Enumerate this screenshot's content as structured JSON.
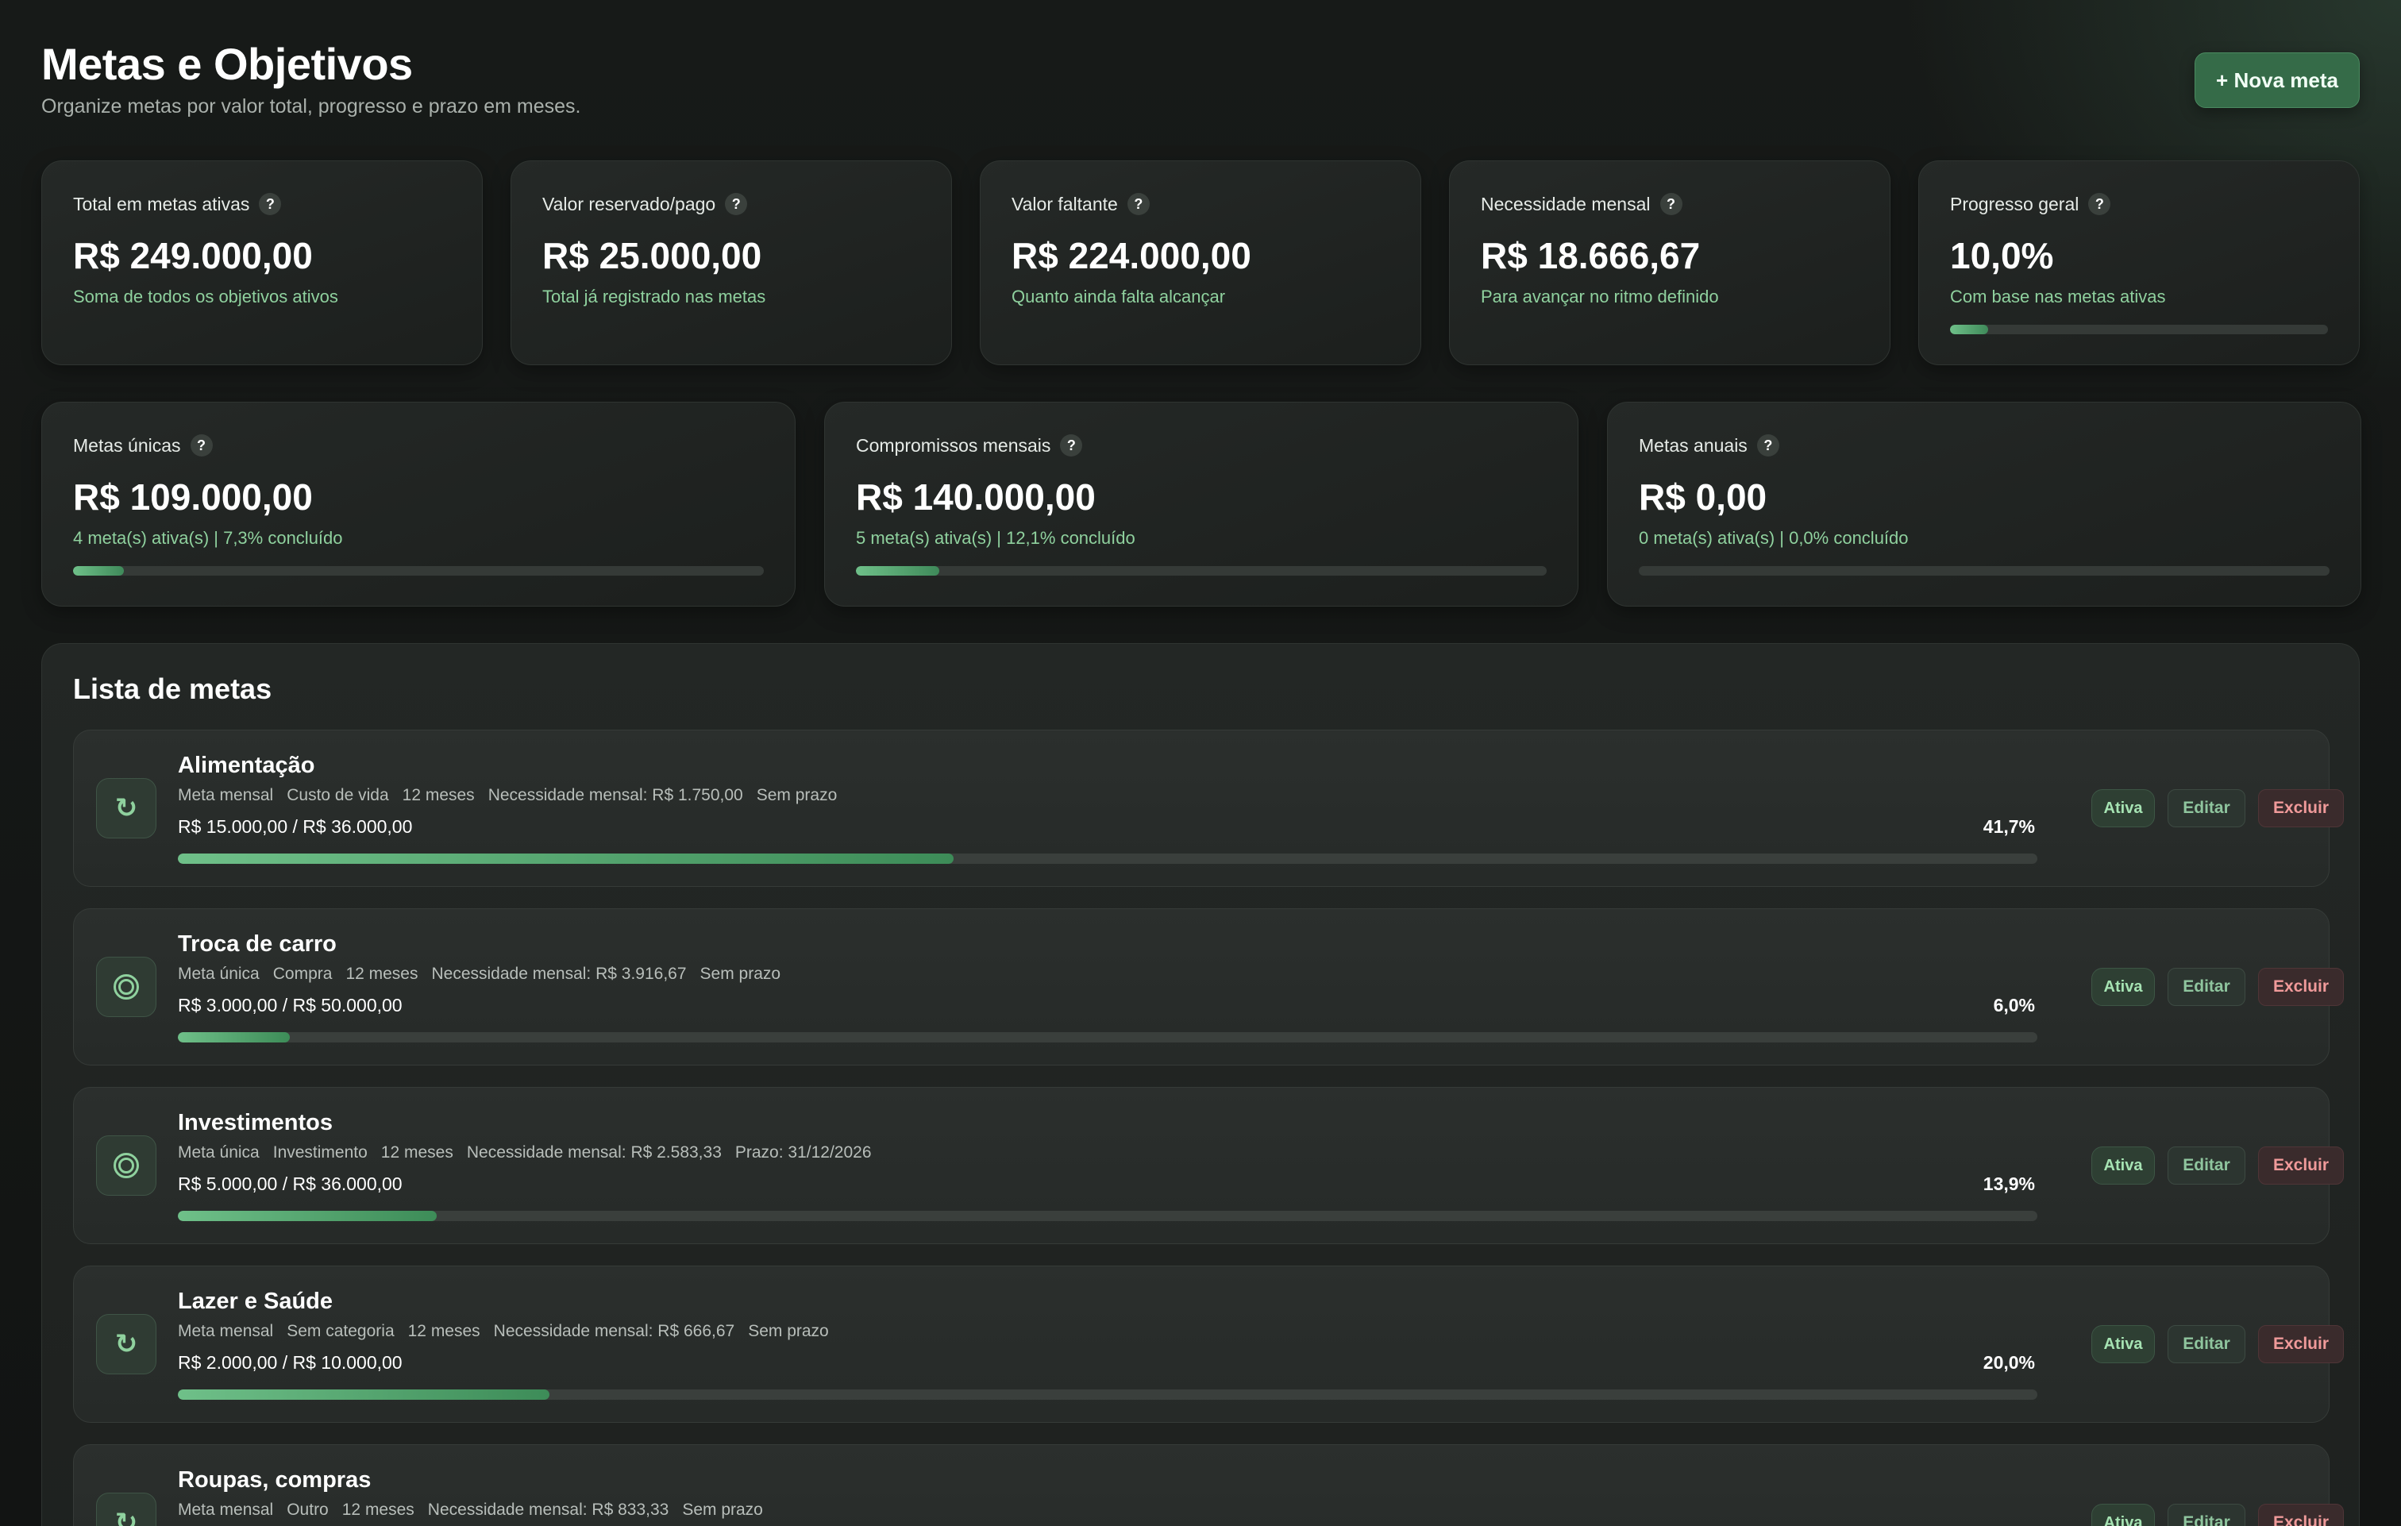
{
  "header": {
    "title": "Metas e Objetivos",
    "subtitle": "Organize metas por valor total, progresso e prazo em meses.",
    "new_goal_label": "+ Nova meta"
  },
  "summary_cards": [
    {
      "label": "Total em metas ativas",
      "value": "R$ 249.000,00",
      "caption": "Soma de todos os objetivos ativos"
    },
    {
      "label": "Valor reservado/pago",
      "value": "R$ 25.000,00",
      "caption": "Total já registrado nas metas"
    },
    {
      "label": "Valor faltante",
      "value": "R$ 224.000,00",
      "caption": "Quanto ainda falta alcançar"
    },
    {
      "label": "Necessidade mensal",
      "value": "R$ 18.666,67",
      "caption": "Para avançar no ritmo definido"
    },
    {
      "label": "Progresso geral",
      "value": "10,0%",
      "caption": "Com base nas metas ativas",
      "progress": 0.1
    }
  ],
  "type_cards": [
    {
      "label": "Metas únicas",
      "value": "R$ 109.000,00",
      "caption": "4 meta(s) ativa(s) | 7,3% concluído",
      "progress": 0.073
    },
    {
      "label": "Compromissos mensais",
      "value": "R$ 140.000,00",
      "caption": "5 meta(s) ativa(s) | 12,1% concluído",
      "progress": 0.121
    },
    {
      "label": "Metas anuais",
      "value": "R$ 0,00",
      "caption": "0 meta(s) ativa(s) | 0,0% concluído",
      "progress": 0.0
    }
  ],
  "help_icon_glyph": "?",
  "list": {
    "title": "Lista de metas",
    "goals": [
      {
        "icon": "refresh-icon",
        "icon_glyph": "↻",
        "name": "Alimentação",
        "meta": [
          "Meta mensal",
          "Custo de vida",
          "12 meses",
          "Necessidade mensal: R$ 1.750,00",
          "Sem prazo"
        ],
        "amounts": "R$ 15.000,00 / R$ 36.000,00",
        "percent": "41,7%",
        "progress": 0.417,
        "status": "Ativa",
        "edit": "Editar",
        "delete": "Excluir"
      },
      {
        "icon": "target-icon",
        "icon_glyph": "",
        "name": "Troca de carro",
        "meta": [
          "Meta única",
          "Compra",
          "12 meses",
          "Necessidade mensal: R$ 3.916,67",
          "Sem prazo"
        ],
        "amounts": "R$ 3.000,00 / R$ 50.000,00",
        "percent": "6,0%",
        "progress": 0.06,
        "status": "Ativa",
        "edit": "Editar",
        "delete": "Excluir"
      },
      {
        "icon": "target-icon",
        "icon_glyph": "",
        "name": "Investimentos",
        "meta": [
          "Meta única",
          "Investimento",
          "12 meses",
          "Necessidade mensal: R$ 2.583,33",
          "Prazo: 31/12/2026"
        ],
        "amounts": "R$ 5.000,00 / R$ 36.000,00",
        "percent": "13,9%",
        "progress": 0.139,
        "status": "Ativa",
        "edit": "Editar",
        "delete": "Excluir"
      },
      {
        "icon": "refresh-icon",
        "icon_glyph": "↻",
        "name": "Lazer e Saúde",
        "meta": [
          "Meta mensal",
          "Sem categoria",
          "12 meses",
          "Necessidade mensal: R$ 666,67",
          "Sem prazo"
        ],
        "amounts": "R$ 2.000,00 / R$ 10.000,00",
        "percent": "20,0%",
        "progress": 0.2,
        "status": "Ativa",
        "edit": "Editar",
        "delete": "Excluir"
      },
      {
        "icon": "refresh-icon",
        "icon_glyph": "↻",
        "name": "Roupas, compras",
        "meta": [
          "Meta mensal",
          "Outro",
          "12 meses",
          "Necessidade mensal: R$ 833,33",
          "Sem prazo"
        ],
        "amounts": "",
        "percent": "",
        "progress": 0,
        "status": "Ativa",
        "edit": "Editar",
        "delete": "Excluir"
      }
    ]
  },
  "colors": {
    "accent": "#356b48",
    "positive_text": "#8fd19e",
    "delete_text": "#f09a9a",
    "background": "#151816"
  }
}
